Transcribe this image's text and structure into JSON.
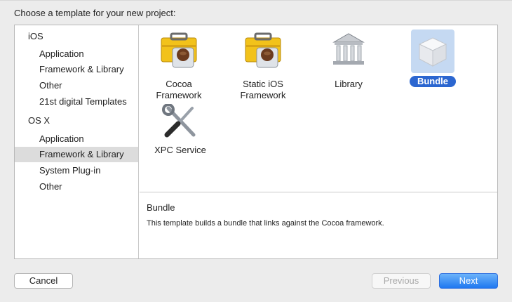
{
  "dialog": {
    "title": "Choose a template for your new project:"
  },
  "sidebar": {
    "sections": [
      {
        "name": "iOS",
        "items": [
          "Application",
          "Framework & Library",
          "Other",
          "21st digital Templates"
        ]
      },
      {
        "name": "OS X",
        "items": [
          "Application",
          "Framework & Library",
          "System Plug-in",
          "Other"
        ]
      }
    ],
    "selected": "OS X / Framework & Library"
  },
  "templates": [
    {
      "label": "Cocoa\nFramework",
      "icon": "toolbox-icon"
    },
    {
      "label": "Static iOS\nFramework",
      "icon": "toolbox-icon"
    },
    {
      "label": "Library",
      "icon": "library-building-icon"
    },
    {
      "label": "Bundle",
      "icon": "bundle-cube-icon",
      "selected": true
    },
    {
      "label": "XPC Service",
      "icon": "wrench-screwdriver-icon"
    }
  ],
  "description": {
    "title": "Bundle",
    "text": "This template builds a bundle that links against the Cocoa framework."
  },
  "buttons": {
    "cancel": "Cancel",
    "previous": "Previous",
    "next": "Next"
  },
  "colors": {
    "selection_blue": "#2b66d0",
    "next_button": "#1f77f0",
    "sidebar_selected": "#dcdcdc"
  }
}
